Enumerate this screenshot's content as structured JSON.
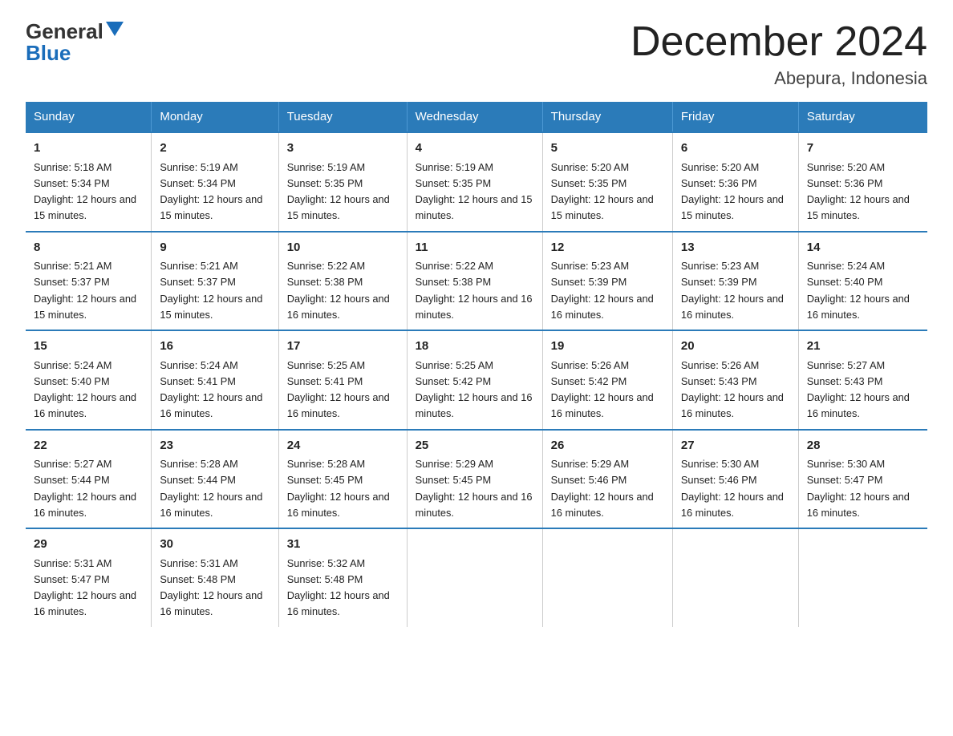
{
  "header": {
    "logo_general": "General",
    "logo_blue": "Blue",
    "title": "December 2024",
    "subtitle": "Abepura, Indonesia"
  },
  "days_of_week": [
    "Sunday",
    "Monday",
    "Tuesday",
    "Wednesday",
    "Thursday",
    "Friday",
    "Saturday"
  ],
  "weeks": [
    [
      {
        "day": "1",
        "sunrise": "5:18 AM",
        "sunset": "5:34 PM",
        "daylight": "12 hours and 15 minutes."
      },
      {
        "day": "2",
        "sunrise": "5:19 AM",
        "sunset": "5:34 PM",
        "daylight": "12 hours and 15 minutes."
      },
      {
        "day": "3",
        "sunrise": "5:19 AM",
        "sunset": "5:35 PM",
        "daylight": "12 hours and 15 minutes."
      },
      {
        "day": "4",
        "sunrise": "5:19 AM",
        "sunset": "5:35 PM",
        "daylight": "12 hours and 15 minutes."
      },
      {
        "day": "5",
        "sunrise": "5:20 AM",
        "sunset": "5:35 PM",
        "daylight": "12 hours and 15 minutes."
      },
      {
        "day": "6",
        "sunrise": "5:20 AM",
        "sunset": "5:36 PM",
        "daylight": "12 hours and 15 minutes."
      },
      {
        "day": "7",
        "sunrise": "5:20 AM",
        "sunset": "5:36 PM",
        "daylight": "12 hours and 15 minutes."
      }
    ],
    [
      {
        "day": "8",
        "sunrise": "5:21 AM",
        "sunset": "5:37 PM",
        "daylight": "12 hours and 15 minutes."
      },
      {
        "day": "9",
        "sunrise": "5:21 AM",
        "sunset": "5:37 PM",
        "daylight": "12 hours and 15 minutes."
      },
      {
        "day": "10",
        "sunrise": "5:22 AM",
        "sunset": "5:38 PM",
        "daylight": "12 hours and 16 minutes."
      },
      {
        "day": "11",
        "sunrise": "5:22 AM",
        "sunset": "5:38 PM",
        "daylight": "12 hours and 16 minutes."
      },
      {
        "day": "12",
        "sunrise": "5:23 AM",
        "sunset": "5:39 PM",
        "daylight": "12 hours and 16 minutes."
      },
      {
        "day": "13",
        "sunrise": "5:23 AM",
        "sunset": "5:39 PM",
        "daylight": "12 hours and 16 minutes."
      },
      {
        "day": "14",
        "sunrise": "5:24 AM",
        "sunset": "5:40 PM",
        "daylight": "12 hours and 16 minutes."
      }
    ],
    [
      {
        "day": "15",
        "sunrise": "5:24 AM",
        "sunset": "5:40 PM",
        "daylight": "12 hours and 16 minutes."
      },
      {
        "day": "16",
        "sunrise": "5:24 AM",
        "sunset": "5:41 PM",
        "daylight": "12 hours and 16 minutes."
      },
      {
        "day": "17",
        "sunrise": "5:25 AM",
        "sunset": "5:41 PM",
        "daylight": "12 hours and 16 minutes."
      },
      {
        "day": "18",
        "sunrise": "5:25 AM",
        "sunset": "5:42 PM",
        "daylight": "12 hours and 16 minutes."
      },
      {
        "day": "19",
        "sunrise": "5:26 AM",
        "sunset": "5:42 PM",
        "daylight": "12 hours and 16 minutes."
      },
      {
        "day": "20",
        "sunrise": "5:26 AM",
        "sunset": "5:43 PM",
        "daylight": "12 hours and 16 minutes."
      },
      {
        "day": "21",
        "sunrise": "5:27 AM",
        "sunset": "5:43 PM",
        "daylight": "12 hours and 16 minutes."
      }
    ],
    [
      {
        "day": "22",
        "sunrise": "5:27 AM",
        "sunset": "5:44 PM",
        "daylight": "12 hours and 16 minutes."
      },
      {
        "day": "23",
        "sunrise": "5:28 AM",
        "sunset": "5:44 PM",
        "daylight": "12 hours and 16 minutes."
      },
      {
        "day": "24",
        "sunrise": "5:28 AM",
        "sunset": "5:45 PM",
        "daylight": "12 hours and 16 minutes."
      },
      {
        "day": "25",
        "sunrise": "5:29 AM",
        "sunset": "5:45 PM",
        "daylight": "12 hours and 16 minutes."
      },
      {
        "day": "26",
        "sunrise": "5:29 AM",
        "sunset": "5:46 PM",
        "daylight": "12 hours and 16 minutes."
      },
      {
        "day": "27",
        "sunrise": "5:30 AM",
        "sunset": "5:46 PM",
        "daylight": "12 hours and 16 minutes."
      },
      {
        "day": "28",
        "sunrise": "5:30 AM",
        "sunset": "5:47 PM",
        "daylight": "12 hours and 16 minutes."
      }
    ],
    [
      {
        "day": "29",
        "sunrise": "5:31 AM",
        "sunset": "5:47 PM",
        "daylight": "12 hours and 16 minutes."
      },
      {
        "day": "30",
        "sunrise": "5:31 AM",
        "sunset": "5:48 PM",
        "daylight": "12 hours and 16 minutes."
      },
      {
        "day": "31",
        "sunrise": "5:32 AM",
        "sunset": "5:48 PM",
        "daylight": "12 hours and 16 minutes."
      },
      null,
      null,
      null,
      null
    ]
  ]
}
